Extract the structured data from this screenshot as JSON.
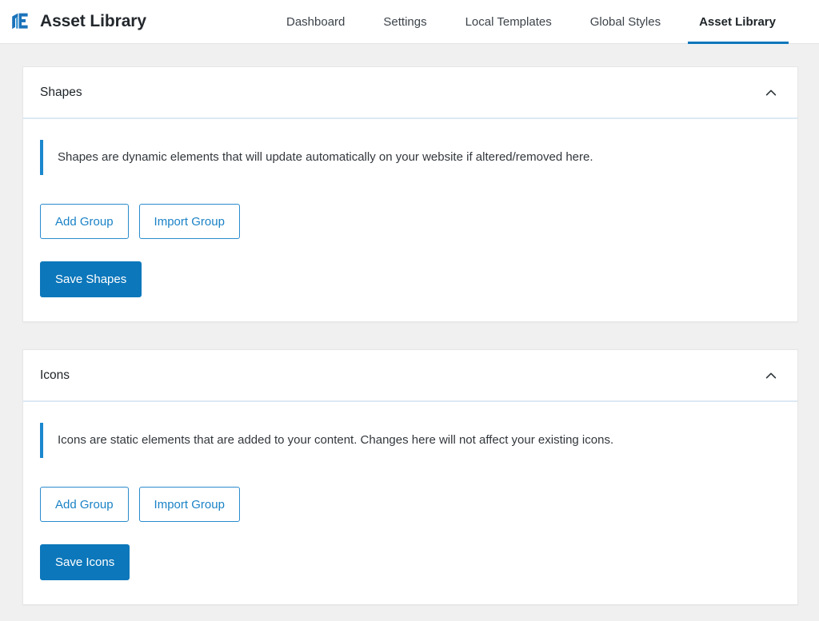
{
  "header": {
    "logo_icon": "layered-book-logo-icon",
    "title": "Asset Library",
    "nav": [
      {
        "label": "Dashboard",
        "active": false
      },
      {
        "label": "Settings",
        "active": false
      },
      {
        "label": "Local Templates",
        "active": false
      },
      {
        "label": "Global Styles",
        "active": false
      },
      {
        "label": "Asset Library",
        "active": true
      }
    ]
  },
  "panels": [
    {
      "title": "Shapes",
      "collapse_icon": "chevron-up-icon",
      "notice": "Shapes are dynamic elements that will update automatically on your website if altered/removed here.",
      "add_group_label": "Add Group",
      "import_group_label": "Import Group",
      "save_label": "Save Shapes"
    },
    {
      "title": "Icons",
      "collapse_icon": "chevron-up-icon",
      "notice": "Icons are static elements that are added to your content. Changes here will not affect your existing icons.",
      "add_group_label": "Add Group",
      "import_group_label": "Import Group",
      "save_label": "Save Icons"
    }
  ],
  "colors": {
    "accent_blue": "#0c77bb",
    "notice_bar_blue": "#1b87ce",
    "outline_blue": "#2a8bcd",
    "page_background": "#f0f0f1",
    "panel_background": "#ffffff",
    "divider": "#dce9f3",
    "text_dark": "#1d2327",
    "text_body": "#32373c"
  }
}
